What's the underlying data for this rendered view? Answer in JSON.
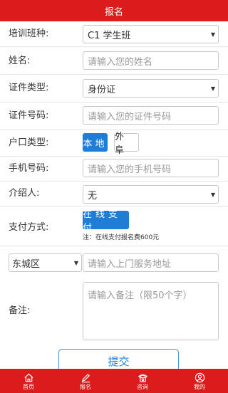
{
  "header": {
    "title": "报名"
  },
  "form": {
    "class_label": "培训班种:",
    "class_value": "C1 学生班",
    "name_label": "姓名:",
    "name_placeholder": "请输入您的姓名",
    "id_type_label": "证件类型:",
    "id_type_value": "身份证",
    "id_number_label": "证件号码:",
    "id_number_placeholder": "请输入您的证件号码",
    "hukou_label": "户口类型:",
    "hukou_options": [
      "本地",
      "外阜"
    ],
    "hukou_selected": "本地",
    "phone_label": "手机号码:",
    "phone_placeholder": "请输入您的手机号码",
    "referrer_label": "介绍人:",
    "referrer_value": "无",
    "payment_label": "支付方式:",
    "payment_option": "在线支付",
    "payment_note": "注：在线支付报名费600元",
    "district_value": "东城区",
    "address_placeholder": "请输入上门服务地址",
    "remark_label": "备注:",
    "remark_placeholder": "请输入备注（限50个字）",
    "submit_label": "提交"
  },
  "tabbar": {
    "items": [
      {
        "label": "首页",
        "icon": "home-icon"
      },
      {
        "label": "报名",
        "icon": "edit-icon"
      },
      {
        "label": "咨询",
        "icon": "phone-icon"
      },
      {
        "label": "我的",
        "icon": "user-icon"
      }
    ]
  },
  "colors": {
    "brand_red": "#dc1b1b",
    "accent_blue": "#1f7dd6"
  }
}
